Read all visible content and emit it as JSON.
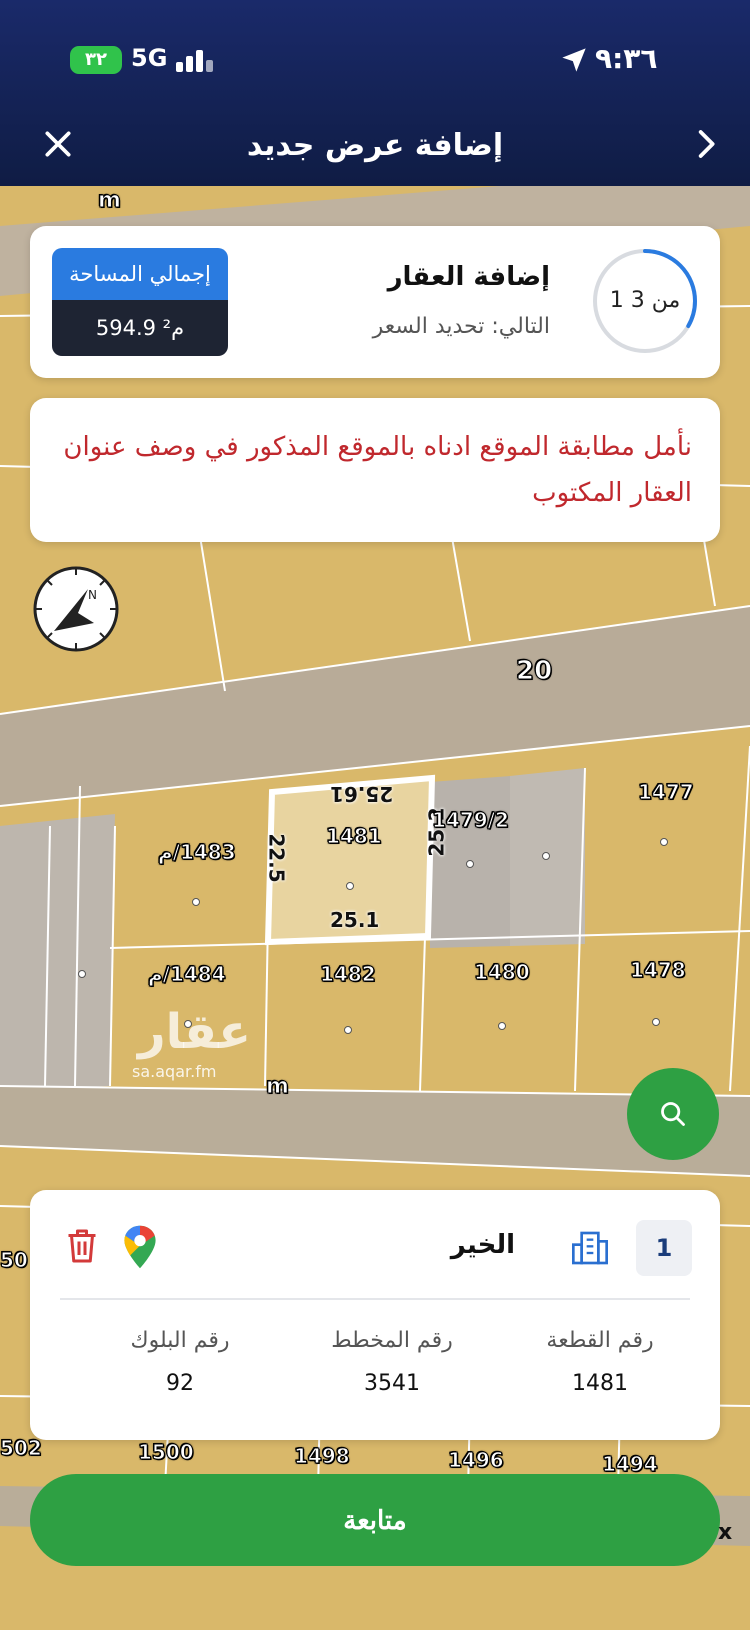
{
  "status_bar": {
    "battery": "٣٢",
    "network": "5G",
    "time": "٩:٣٦"
  },
  "header": {
    "title": "إضافة عرض جديد"
  },
  "progress_card": {
    "step_counter": "1 من 3",
    "step_fraction": 0.333,
    "title": "إضافة العقار",
    "next": "التالي: تحديد السعر",
    "area_label": "إجمالي المساحة",
    "area_value": "594.9 م²"
  },
  "notice": {
    "text": "نأمل مطابقة الموقع ادناه بالموقع المذكور في وصف عنوان العقار المكتوب"
  },
  "map": {
    "road_label_main": "20",
    "road_label_m": "m",
    "dimensions": {
      "top": "25.61",
      "right": "25.2",
      "bottom": "25.1",
      "left": "22.5"
    },
    "selected_parcel": "1481",
    "parcels": [
      "1477",
      "1479/2",
      "1483/م",
      "1484/م",
      "1482",
      "1480",
      "1478",
      "1500",
      "1498",
      "1496",
      "1494",
      "502",
      "50"
    ],
    "watermark": "عقار",
    "watermark_url": "sa.aqar.fm"
  },
  "property": {
    "index": "1",
    "name": "الخير",
    "parcel_label": "رقم القطعة",
    "parcel_value": "1481",
    "plan_label": "رقم المخطط",
    "plan_value": "3541",
    "block_label": "رقم البلوك",
    "block_value": "92"
  },
  "actions": {
    "continue_label": "متابعة",
    "close_label": "x"
  },
  "colors": {
    "header": "#13215a",
    "accent_green": "#2ea043",
    "accent_blue": "#2a7be0",
    "notice_red": "#c0282d",
    "land": "#dcbc6c",
    "road": "#b8ab98"
  }
}
